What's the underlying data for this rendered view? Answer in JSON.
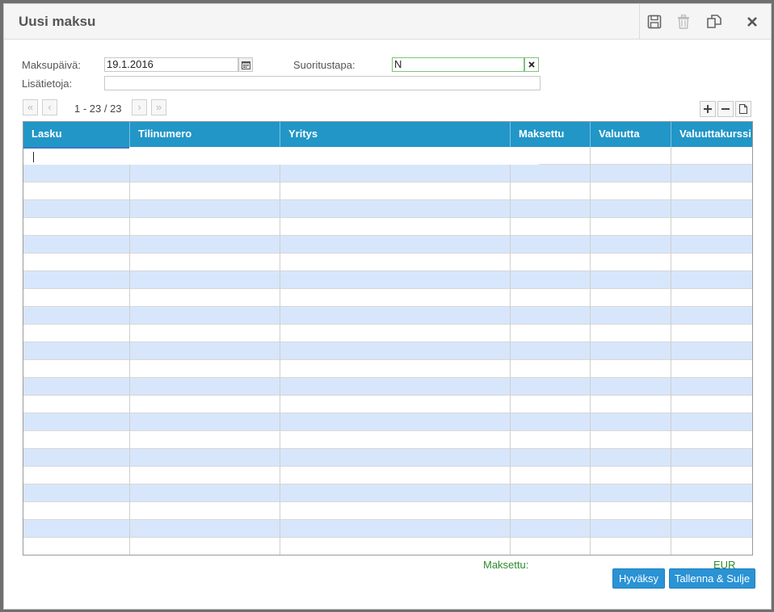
{
  "dialog": {
    "title": "Uusi maksu",
    "tools": [
      "save-icon",
      "trash-icon",
      "copy-icon",
      "close-icon"
    ]
  },
  "form": {
    "date_label": "Maksupäivä:",
    "date_value": "19.1.2016",
    "method_label": "Suoritustapa:",
    "method_value": "N",
    "notes_label": "Lisätietoja:",
    "notes_value": ""
  },
  "pager": {
    "info": "1 - 23 / 23"
  },
  "grid": {
    "columns": [
      "Lasku",
      "Tilinumero",
      "Yritys",
      "Maksettu",
      "Valuutta",
      "Valuuttakurssi"
    ],
    "row_count": 23,
    "colors": {
      "header": "#2196c7",
      "alt_row": "#d7e6fb"
    }
  },
  "footer": {
    "paid_label": "Maksettu:",
    "currency": "EUR",
    "accept_button": "Hyväksy",
    "save_close_button": "Tallenna & Sulje"
  }
}
